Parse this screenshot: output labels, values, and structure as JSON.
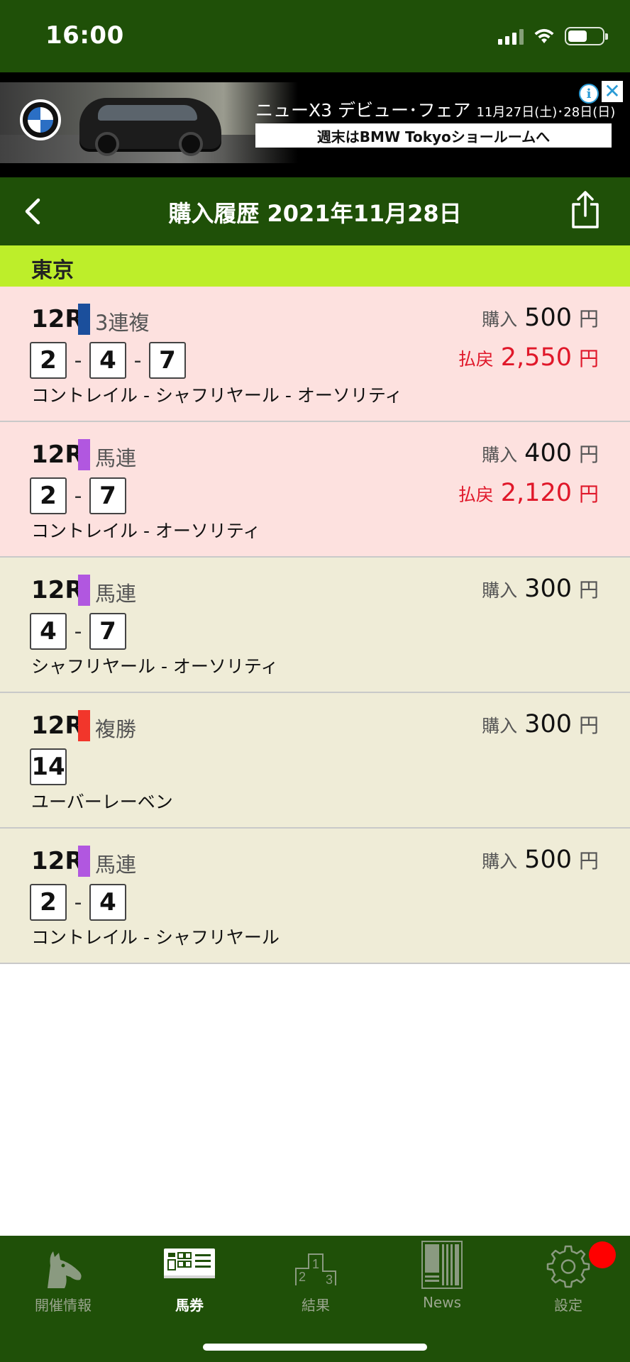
{
  "status_bar": {
    "time": "16:00"
  },
  "ad": {
    "title": "ニューX3 デビュー･フェア",
    "date": "11月27日(土)･28日(日)",
    "subtitle": "週末はBMW Tokyoショールームへ"
  },
  "nav": {
    "title": "購入履歴 2021年11月28日"
  },
  "venue": {
    "name": "東京"
  },
  "tickets": [
    {
      "race": "12R",
      "type": "3連複",
      "type_color": "#1b4f9c",
      "purchase_label": "購入",
      "purchase_amount": "500",
      "yen": "円",
      "payout_label": "払戻",
      "payout_amount": "2,550",
      "numbers": [
        "2",
        "4",
        "7"
      ],
      "horses": "コントレイル - シャフリヤール - オーソリティ",
      "status": "win"
    },
    {
      "race": "12R",
      "type": "馬連",
      "type_color": "#b157e0",
      "purchase_label": "購入",
      "purchase_amount": "400",
      "yen": "円",
      "payout_label": "払戻",
      "payout_amount": "2,120",
      "numbers": [
        "2",
        "7"
      ],
      "horses": "コントレイル - オーソリティ",
      "status": "win"
    },
    {
      "race": "12R",
      "type": "馬連",
      "type_color": "#b157e0",
      "purchase_label": "購入",
      "purchase_amount": "300",
      "yen": "円",
      "numbers": [
        "4",
        "7"
      ],
      "horses": "シャフリヤール - オーソリティ",
      "status": "lose"
    },
    {
      "race": "12R",
      "type": "複勝",
      "type_color": "#f2362b",
      "purchase_label": "購入",
      "purchase_amount": "300",
      "yen": "円",
      "numbers": [
        "14"
      ],
      "horses": "ユーバーレーベン",
      "status": "lose"
    },
    {
      "race": "12R",
      "type": "馬連",
      "type_color": "#b157e0",
      "purchase_label": "購入",
      "purchase_amount": "500",
      "yen": "円",
      "numbers": [
        "2",
        "4"
      ],
      "horses": "コントレイル - シャフリヤール",
      "status": "lose"
    }
  ],
  "number_separator": "-",
  "tab_bar": {
    "tabs": [
      {
        "label": "開催情報",
        "icon": "horse-head-icon",
        "active": false
      },
      {
        "label": "馬券",
        "icon": "ticket-icon",
        "active": true
      },
      {
        "label": "結果",
        "icon": "podium-icon",
        "active": false
      },
      {
        "label": "News",
        "icon": "news-icon",
        "active": false
      },
      {
        "label": "設定",
        "icon": "gear-icon",
        "active": false
      }
    ]
  },
  "colors": {
    "header_green": "#1f5008",
    "venue_bar": "#bdee2a",
    "win_row": "#fde1df",
    "lose_row": "#efecd7",
    "payout_red": "#e0182a",
    "notification_red": "#ff0000"
  }
}
